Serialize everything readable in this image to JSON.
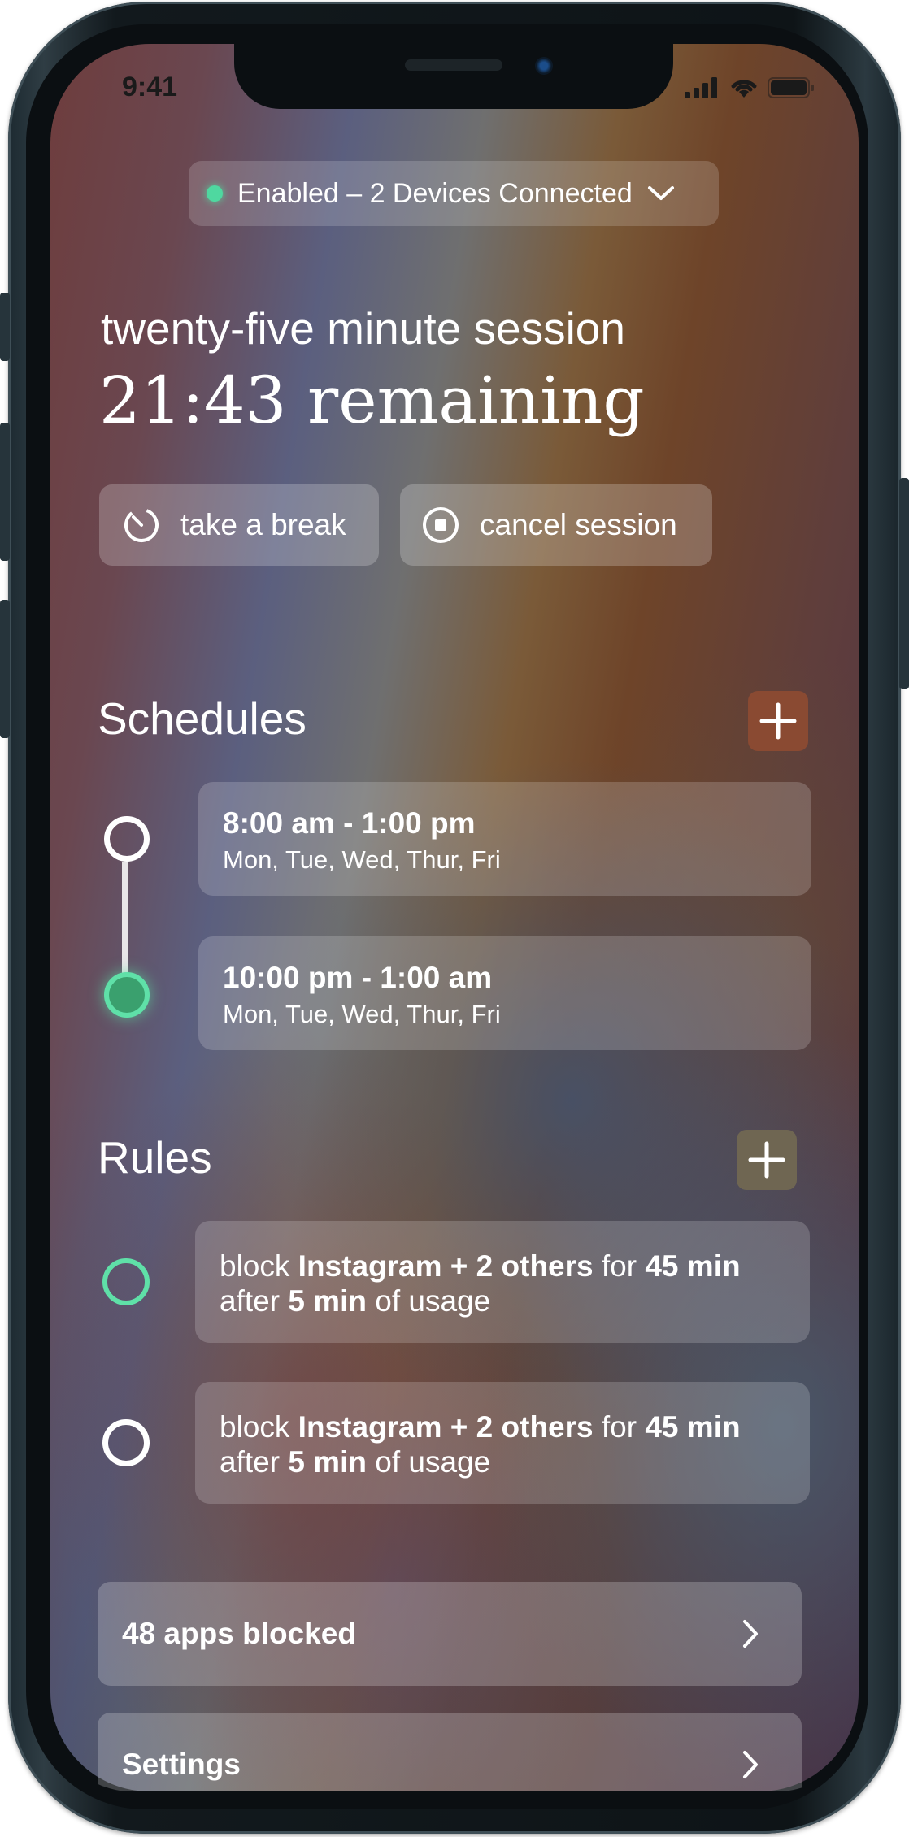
{
  "status_bar": {
    "time": "9:41",
    "icons": [
      "signal-icon",
      "wifi-icon",
      "battery-icon"
    ]
  },
  "connection": {
    "label": "Enabled – 2 Devices Connected",
    "status_color": "#4fd8a0"
  },
  "session": {
    "title": "twenty-five minute session",
    "remaining": "21:43 remaining",
    "break_label": "take a break",
    "cancel_label": "cancel session"
  },
  "schedules": {
    "title": "Schedules",
    "items": [
      {
        "time": "8:00 am - 1:00 pm",
        "days": "Mon, Tue, Wed, Thur, Fri",
        "active": false
      },
      {
        "time": "10:00 pm - 1:00 am",
        "days": "Mon, Tue, Wed, Thur, Fri",
        "active": true
      }
    ]
  },
  "rules": {
    "title": "Rules",
    "items": [
      {
        "block_word": "block",
        "apps": "Instagram + 2 others",
        "for_word": "for",
        "duration": "45 min",
        "after_word": "after",
        "usage": "5 min",
        "tail": "of usage",
        "active": true
      },
      {
        "block_word": "block",
        "apps": "Instagram + 2 others",
        "for_word": "for",
        "duration": "45 min",
        "after_word": "after",
        "usage": "5 min",
        "tail": "of usage",
        "active": false
      }
    ]
  },
  "nav": {
    "apps_blocked": "48 apps blocked",
    "settings": "Settings"
  },
  "colors": {
    "accent_green": "#4fd8a0",
    "schedules_add_bg": "#8a4a32",
    "rules_add_bg": "#6f6652"
  }
}
